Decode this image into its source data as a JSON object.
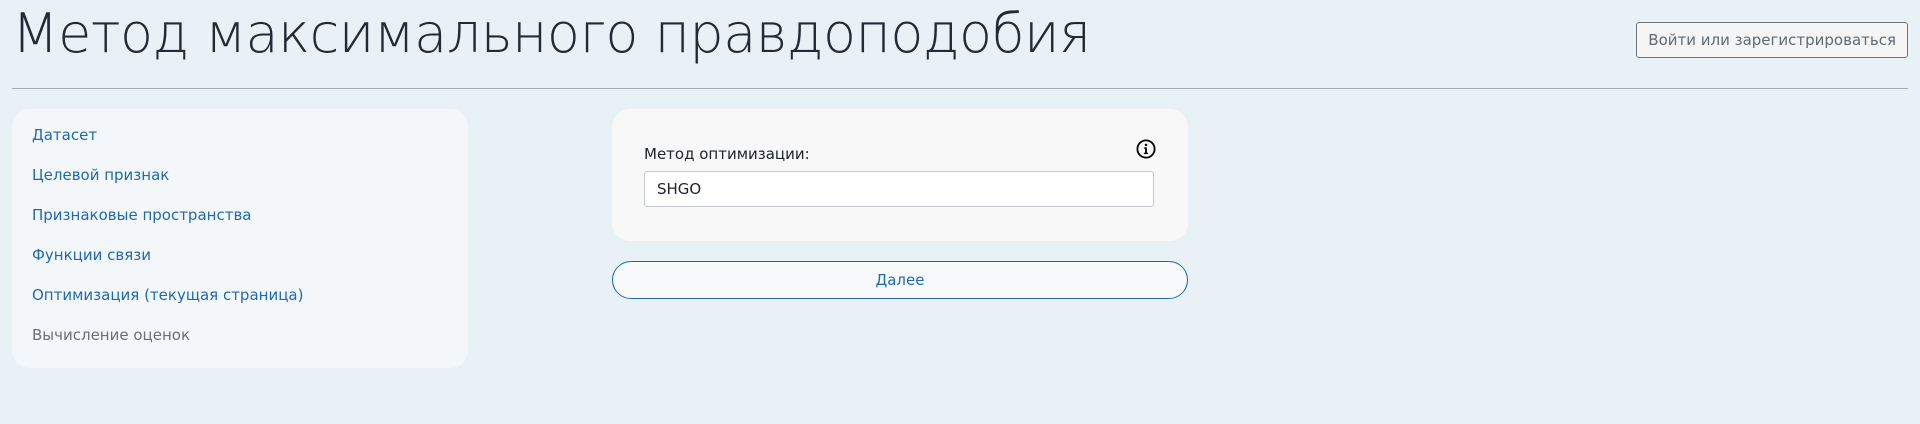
{
  "header": {
    "title": "Метод максимального правдоподобия",
    "login_label": "Войти или зарегистрироваться"
  },
  "sidebar": {
    "items": [
      {
        "label": "Датасет",
        "state": "link"
      },
      {
        "label": "Целевой признак",
        "state": "link"
      },
      {
        "label": "Признаковые пространства",
        "state": "link"
      },
      {
        "label": "Функции связи",
        "state": "link"
      },
      {
        "label": "Оптимизация (текущая страница)",
        "state": "current"
      },
      {
        "label": "Вычисление оценок",
        "state": "disabled"
      }
    ]
  },
  "form": {
    "optimization_label": "Метод оптимизации:",
    "optimization_value": "SHGO",
    "info_icon": "info-circle-icon"
  },
  "actions": {
    "next_label": "Далее"
  },
  "colors": {
    "background": "#e8f1f6",
    "link": "#1f69b3",
    "disabled_text": "#6b7078",
    "card": "#f8f8f8"
  }
}
